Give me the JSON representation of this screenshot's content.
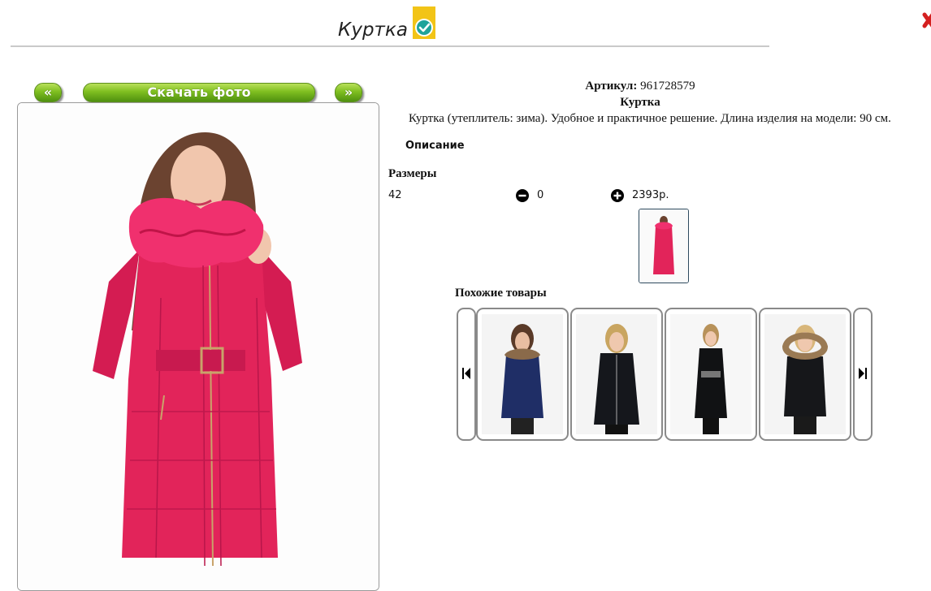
{
  "header": {
    "title": "Куртка"
  },
  "gallery": {
    "prev_label": "«",
    "download_label": "Скачать фото",
    "next_label": "»"
  },
  "product": {
    "article_label": "Артикул:",
    "article_value": "961728579",
    "name": "Куртка",
    "description": "Куртка (утеплитель: зима). Удобное и практичное решение. Длина изделия на модели: 90 см.",
    "description_heading": "Описание",
    "sizes_heading": "Размеры",
    "size": "42",
    "quantity": "0",
    "price": "2393р."
  },
  "similar": {
    "heading": "Похожие товары",
    "items": [
      {
        "color": "#1f2e66",
        "fur": true
      },
      {
        "color": "#15171c",
        "fur": false
      },
      {
        "color": "#111214",
        "fur": false
      },
      {
        "color": "#16171a",
        "fur": true
      }
    ]
  },
  "colors": {
    "accent_green": "#7fbf20",
    "jacket_red": "#e2245a",
    "fur_pink": "#f0306e",
    "badge_yellow": "#f2c417",
    "badge_teal": "#1fa39a"
  }
}
